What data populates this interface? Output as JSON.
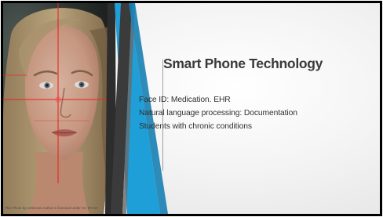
{
  "slide": {
    "title": "Smart Phone Technology",
    "bullets": [
      "Face ID: Medication. EHR",
      "Natural language processing: Documentation",
      "Students with chronic conditions"
    ],
    "bullet_symbol": "•",
    "photo_caption": "This Photo by Unknown Author is licensed under CC BY-SA",
    "colors": {
      "accent_blue": "#1f9fd8",
      "stripe_dark": "#3b3b3b",
      "title": "#3a3a3a",
      "scan_red": "#ff2a2a"
    }
  }
}
